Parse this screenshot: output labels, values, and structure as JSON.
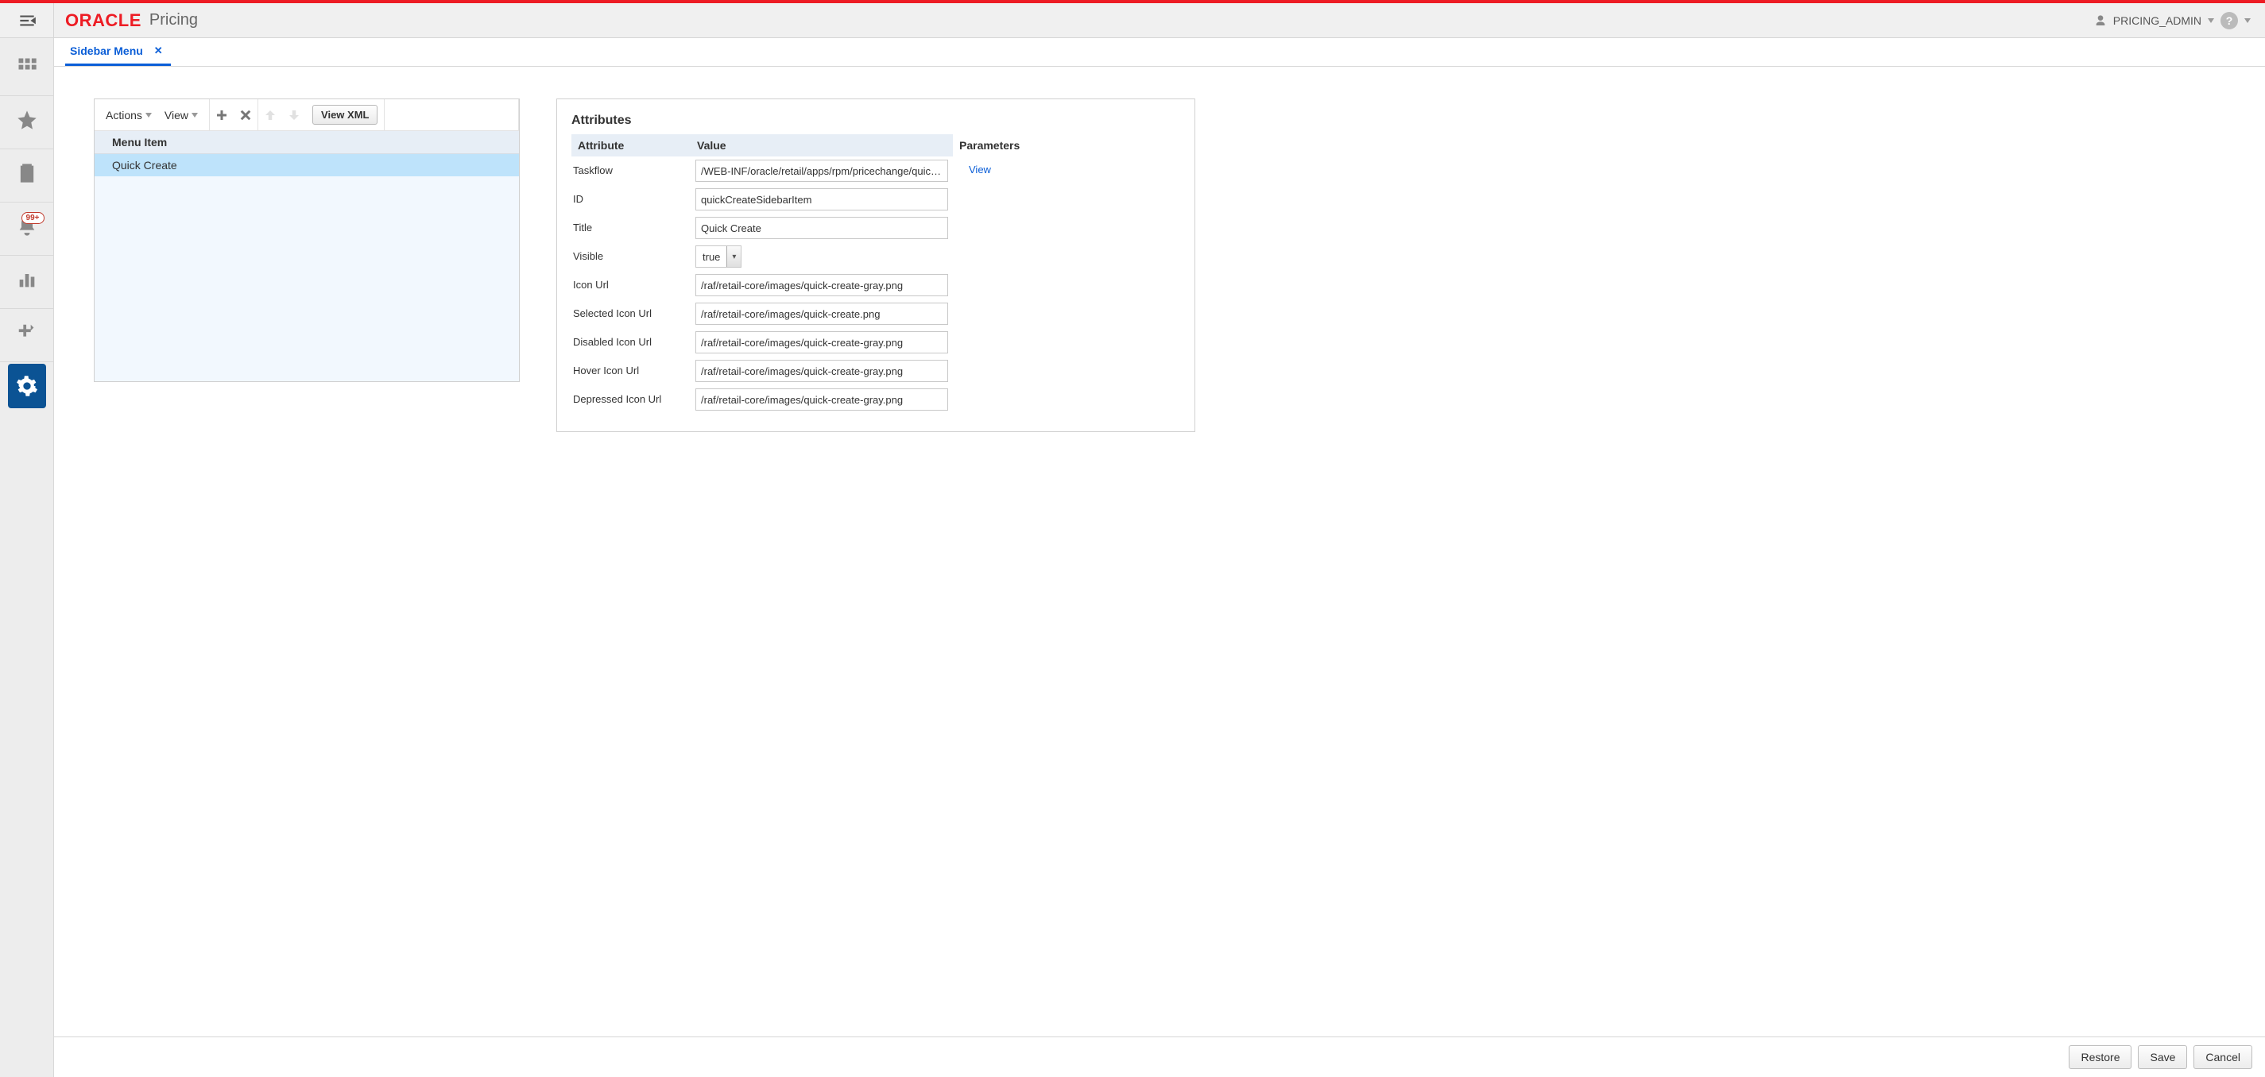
{
  "header": {
    "brand_mark": "ORACLE",
    "app_title": "Pricing",
    "username": "PRICING_ADMIN"
  },
  "sidebar": {
    "notif_badge": "99+"
  },
  "tabs": [
    {
      "label": "Sidebar Menu"
    }
  ],
  "left_panel": {
    "actions_label": "Actions",
    "view_label": "View",
    "view_xml_label": "View XML",
    "column_header": "Menu Item",
    "rows": [
      {
        "label": "Quick Create",
        "selected": true
      }
    ]
  },
  "right_panel": {
    "title": "Attributes",
    "head_attribute": "Attribute",
    "head_value": "Value",
    "head_parameters": "Parameters",
    "param_link_label": "View",
    "attributes": [
      {
        "label": "Taskflow",
        "type": "text",
        "value": "/WEB-INF/oracle/retail/apps/rpm/pricechange/quickcreate"
      },
      {
        "label": "ID",
        "type": "text",
        "value": "quickCreateSidebarItem"
      },
      {
        "label": "Title",
        "type": "text",
        "value": "Quick Create"
      },
      {
        "label": "Visible",
        "type": "select",
        "value": "true"
      },
      {
        "label": "Icon Url",
        "type": "text",
        "value": "/raf/retail-core/images/quick-create-gray.png"
      },
      {
        "label": "Selected Icon Url",
        "type": "text",
        "value": "/raf/retail-core/images/quick-create.png"
      },
      {
        "label": "Disabled Icon Url",
        "type": "text",
        "value": "/raf/retail-core/images/quick-create-gray.png"
      },
      {
        "label": "Hover Icon Url",
        "type": "text",
        "value": "/raf/retail-core/images/quick-create-gray.png"
      },
      {
        "label": "Depressed Icon Url",
        "type": "text",
        "value": "/raf/retail-core/images/quick-create-gray.png"
      }
    ]
  },
  "footer": {
    "restore": "Restore",
    "save": "Save",
    "cancel": "Cancel"
  }
}
